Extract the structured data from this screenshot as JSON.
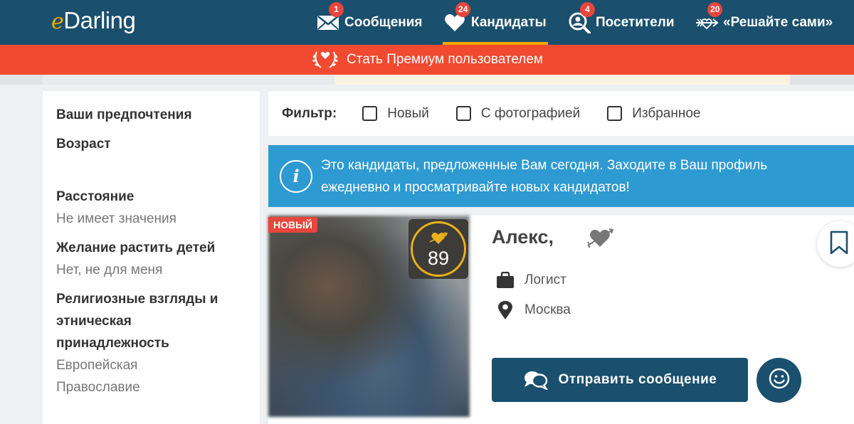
{
  "header": {
    "logo_prefix": "e",
    "logo_text": "Darling",
    "nav": [
      {
        "label": "Сообщения",
        "badge": "1",
        "icon": "envelope-icon"
      },
      {
        "label": "Кандидаты",
        "badge": "24",
        "icon": "heart-icon",
        "active": true
      },
      {
        "label": "Посетители",
        "badge": "4",
        "icon": "visitor-search-icon"
      },
      {
        "label": "«Решайте сами»",
        "badge": "20",
        "icon": "cupid-arrow-icon"
      }
    ]
  },
  "premium": {
    "label": "Стать Премиум пользователем",
    "icon": "laurel-heart-icon"
  },
  "sidebar": {
    "preferences_title": "Ваши предпочтения",
    "age_label": "Возраст",
    "distance_label": "Расстояние",
    "distance_value": "Не имеет значения",
    "children_label": "Желание растить детей",
    "children_value": "Нет, не для меня",
    "religion_label_1": "Религиозные взгляды и",
    "religion_label_2": "этническая",
    "religion_label_3": "принадлежность",
    "religion_value_1": "Европейская",
    "religion_value_2": "Православие"
  },
  "filter": {
    "label": "Фильтр:",
    "options": [
      "Новый",
      "С фотографией",
      "Избранное"
    ]
  },
  "info": {
    "icon": "info-icon",
    "line1": "Это кандидаты, предложенные Вам сегодня. Заходите в Ваш профиль",
    "line2": "ежедневно и просматривайте новых кандидатов!"
  },
  "candidate": {
    "new_badge": "НОВЫЙ",
    "match_score": "89",
    "name": "Алекс,",
    "occupation": "Логист",
    "city": "Москва",
    "send_label": "Отправить сообщение"
  },
  "colors": {
    "header_bg": "#1a4f6e",
    "accent_yellow": "#f2a900",
    "premium_red": "#f24a30",
    "info_blue": "#2e9ad2",
    "badge_red": "#e8453c"
  }
}
